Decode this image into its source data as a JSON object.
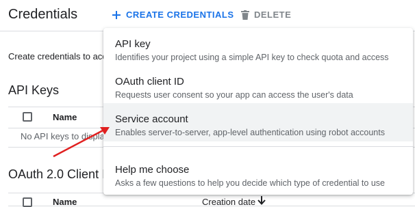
{
  "header": {
    "title": "Credentials",
    "create_label": "CREATE CREDENTIALS",
    "delete_label": "DELETE"
  },
  "intro_text": "Create credentials to acc",
  "api_keys": {
    "heading": "API Keys",
    "column_name": "Name",
    "empty_text": "No API keys to displa"
  },
  "oauth": {
    "heading": "OAuth 2.0 Client I",
    "column_name": "Name",
    "column_creation_date": "Creation date"
  },
  "menu": {
    "items": [
      {
        "title": "API key",
        "description": "Identifies your project using a simple API key to check quota and access"
      },
      {
        "title": "OAuth client ID",
        "description": "Requests user consent so your app can access the user's data"
      },
      {
        "title": "Service account",
        "description": "Enables server-to-server, app-level authentication using robot accounts"
      },
      {
        "title": "Help me choose",
        "description": "Asks a few questions to help you decide which type of credential to use"
      }
    ]
  },
  "colors": {
    "accent": "#1a73e8",
    "annotation_arrow": "#e02020",
    "highlight": "#f1f3f4"
  },
  "icons": {
    "create": "plus-icon",
    "delete": "trash-icon",
    "sort": "arrow-down-icon"
  }
}
